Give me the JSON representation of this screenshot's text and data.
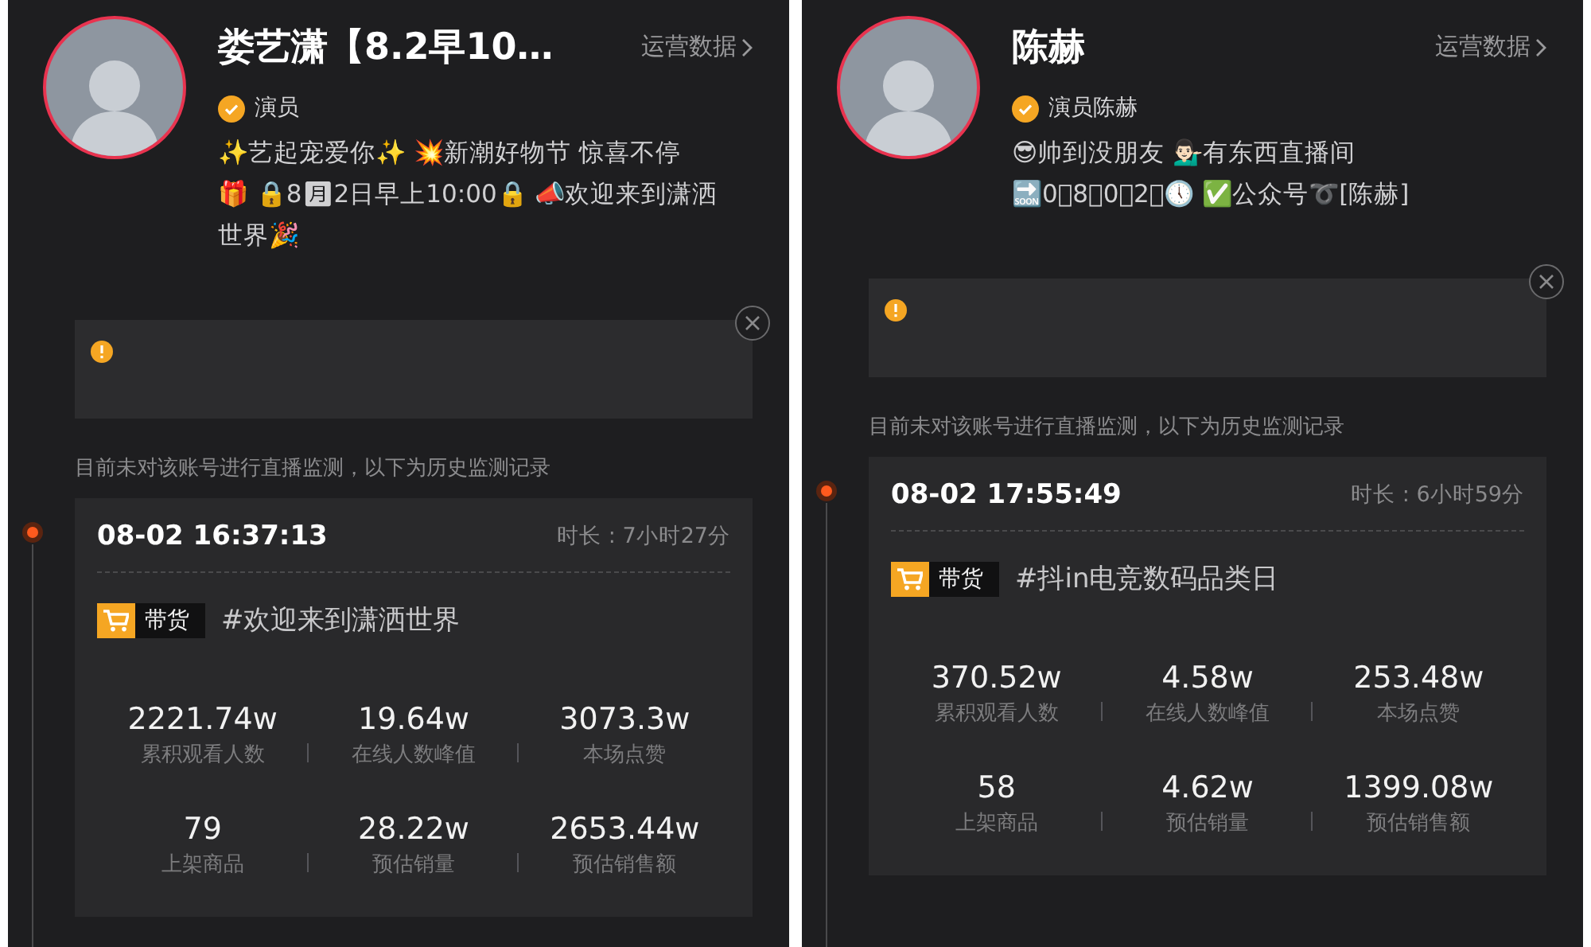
{
  "panels": [
    {
      "name": "娄艺潇【8.2早10…",
      "ops_link": "运营数据",
      "verified_label": "演员",
      "bio_lines": [
        "✨艺起宠爱你✨ 💥新潮好物节 惊喜不停",
        "🎁 🔒8🈷2日早上10:00🔒 📣欢迎来到潇洒",
        "世界🎉"
      ],
      "monitor_note": "目前未对该账号进行直播监测，以下为历史监测记录",
      "sessions": [
        {
          "start": "08-02 16:37:13",
          "duration": "时长 : 7小时27分",
          "tag": "带货",
          "topic": "#欢迎来到潇洒世界",
          "stats": [
            {
              "value": "2221.74w",
              "label": "累积观看人数"
            },
            {
              "value": "19.64w",
              "label": "在线人数峰值"
            },
            {
              "value": "3073.3w",
              "label": "本场点赞"
            },
            {
              "value": "79",
              "label": "上架商品"
            },
            {
              "value": "28.22w",
              "label": "预估销量"
            },
            {
              "value": "2653.44w",
              "label": "预估销售额"
            }
          ]
        }
      ]
    },
    {
      "name": "陈赫",
      "ops_link": "运营数据",
      "verified_label": "演员陈赫",
      "bio_lines": [
        "😎帅到没朋友 💁🏻‍♂️有东西直播间",
        "🔜0⃣8⃣0⃣2⃣🕔 ✅公众号➰[陈赫]"
      ],
      "monitor_note": "目前未对该账号进行直播监测，以下为历史监测记录",
      "sessions": [
        {
          "start": "08-02 17:55:49",
          "duration": "时长 : 6小时59分",
          "tag": "带货",
          "topic": "#抖in电竞数码品类日",
          "stats": [
            {
              "value": "370.52w",
              "label": "累积观看人数"
            },
            {
              "value": "4.58w",
              "label": "在线人数峰值"
            },
            {
              "value": "253.48w",
              "label": "本场点赞"
            },
            {
              "value": "58",
              "label": "上架商品"
            },
            {
              "value": "4.62w",
              "label": "预估销量"
            },
            {
              "value": "1399.08w",
              "label": "预估销售额"
            }
          ]
        }
      ]
    }
  ]
}
